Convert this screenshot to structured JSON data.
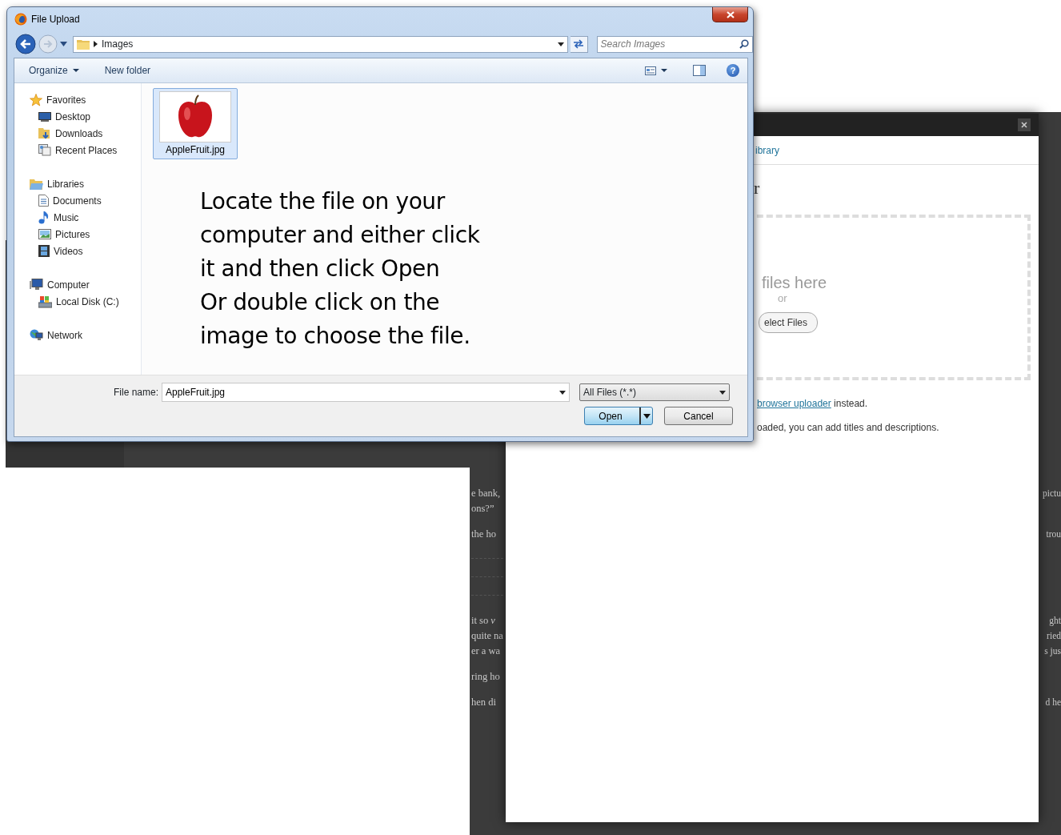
{
  "dialog": {
    "title": "File Upload",
    "address": {
      "crumbs": [
        "Images"
      ]
    },
    "search": {
      "placeholder": "Search Images"
    },
    "toolbar": {
      "items": [
        {
          "label": "Organize",
          "kind": "menu"
        },
        {
          "label": "New folder",
          "kind": "button"
        }
      ],
      "help": "?"
    },
    "nav": [
      {
        "label": "Favorites",
        "children": [
          {
            "label": "Desktop"
          },
          {
            "label": "Downloads"
          },
          {
            "label": "Recent Places"
          }
        ]
      },
      {
        "label": "Libraries",
        "children": [
          {
            "label": "Documents"
          },
          {
            "label": "Music"
          },
          {
            "label": "Pictures"
          },
          {
            "label": "Videos"
          }
        ]
      },
      {
        "label": "Computer",
        "children": [
          {
            "label": "Local Disk (C:)"
          }
        ]
      },
      {
        "label": "Network"
      }
    ],
    "files": [
      {
        "name": "AppleFruit.jpg",
        "selected": true
      }
    ],
    "instructions": [
      "Locate the file on your",
      "computer and either click",
      "it and then click Open",
      "Or double click on the",
      "image to choose the file."
    ],
    "file_name": {
      "label": "File name:",
      "value": "AppleFruit.jpg"
    },
    "file_type": {
      "value": "All Files (*.*)"
    },
    "buttons": [
      {
        "label": "Open",
        "kind": "split",
        "default": true
      },
      {
        "label": "Cancel",
        "kind": "plain",
        "default": false
      }
    ]
  },
  "uploader": {
    "tab": "ibrary",
    "heading": "r",
    "drop_text": "files here",
    "or_text": "or",
    "select_button": "elect Files",
    "fallback": {
      "link": "browser uploader",
      "text": " instead."
    },
    "note": "oaded, you can add titles and descriptions."
  },
  "background_text": [
    {
      "kind": "para",
      "lines": [
        {
          "left": "e bank,",
          "right": "pictu"
        },
        {
          "left": "ons?”"
        }
      ]
    },
    {
      "kind": "para",
      "lines": [
        {
          "left": "the ho",
          "right": "trou"
        }
      ]
    },
    {
      "kind": "rule"
    },
    {
      "kind": "rule"
    },
    {
      "kind": "rule"
    },
    {
      "kind": "para",
      "lines": [
        {
          "left": "it so *v*",
          "right": "ght"
        },
        {
          "left": "quite na",
          "right": "ried"
        },
        {
          "left": "er a wa",
          "right": "s jus"
        }
      ]
    },
    {
      "kind": "para",
      "lines": [
        {
          "left": "ring ho"
        }
      ]
    },
    {
      "kind": "para",
      "lines": [
        {
          "left": "hen di",
          "right": "d he"
        }
      ]
    }
  ]
}
